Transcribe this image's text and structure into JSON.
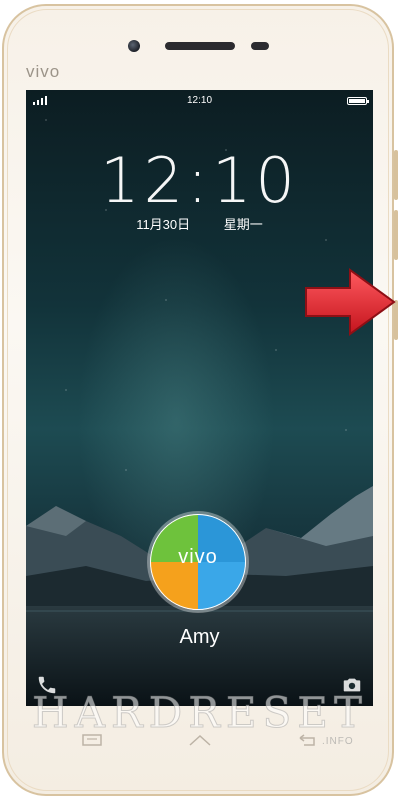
{
  "device": {
    "brand": "vivo"
  },
  "status_bar": {
    "time": "12:10"
  },
  "lockscreen": {
    "clock": "12:10",
    "date": "11月30日",
    "weekday": "星期一",
    "avatar_logo": "vivo",
    "user_name": "Amy"
  },
  "bottom_icons": [
    "phone-icon",
    "camera-icon"
  ],
  "nav_keys": [
    "menu-icon",
    "home-icon",
    "back-icon"
  ],
  "watermark": {
    "text": "HARDRESET",
    "suffix": ".INFO"
  },
  "colors": {
    "arrow": "#e0222b",
    "frame": "#d8c3a0"
  }
}
